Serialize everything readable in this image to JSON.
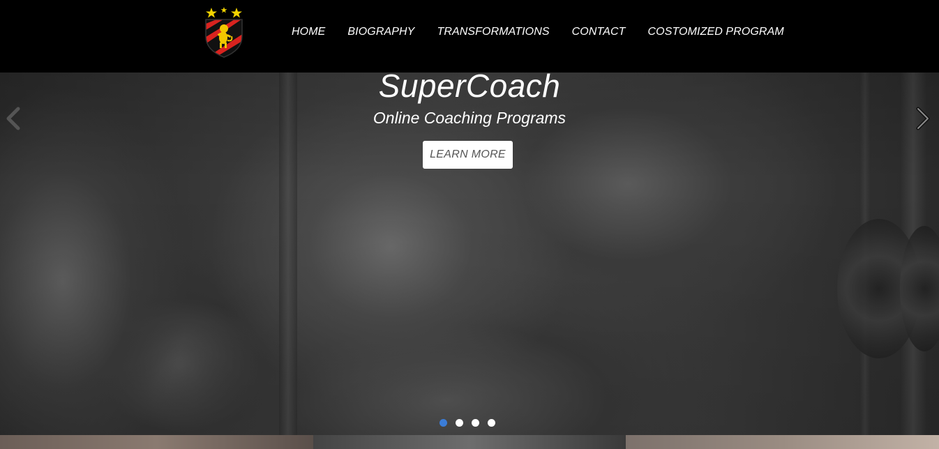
{
  "header": {
    "logo_icon": "crest-lion-logo-icon",
    "logo_colors": {
      "red": "#d8231f",
      "black": "#111111",
      "gold": "#f2c700"
    },
    "nav": [
      {
        "label": "HOME"
      },
      {
        "label": "BIOGRAPHY"
      },
      {
        "label": "TRANSFORMATIONS"
      },
      {
        "label": "CONTACT"
      },
      {
        "label": "COSTOMIZED PROGRAM"
      }
    ]
  },
  "hero": {
    "title": "SuperCoach",
    "subtitle": "Online Coaching Programs",
    "cta_label": "LEARN MORE",
    "prev_icon": "chevron-left-icon",
    "next_icon": "chevron-right-icon",
    "slide_count": 4,
    "active_slide": 1,
    "active_dot_color": "#3b7dd8"
  }
}
